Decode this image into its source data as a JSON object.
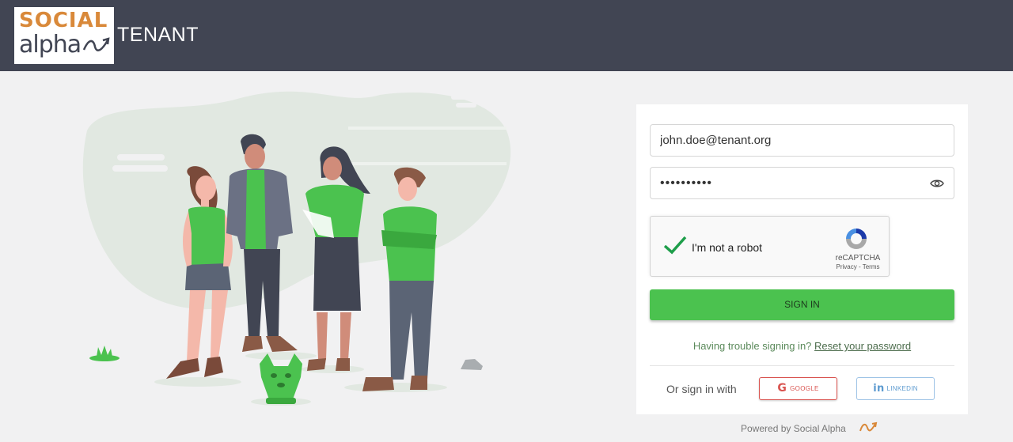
{
  "header": {
    "logo_text_top": "SOCIAL",
    "logo_text_bottom": "alpha",
    "app_name": "TENANT"
  },
  "login": {
    "email_value": "john.doe@tenant.org",
    "password_value": "••••••••••",
    "captcha": {
      "label": "I'm not a robot",
      "brand": "reCAPTCHA",
      "links": "Privacy - Terms",
      "checked": true
    },
    "signin_label": "SIGN IN",
    "trouble_text": "Having trouble signing in?",
    "reset_link": "Reset your password",
    "or_sign_in_with": "Or sign in with",
    "google_label": "GOOGLE",
    "linkedin_label": "LINKEDIN"
  },
  "footer": {
    "powered_by": "Powered by Social Alpha"
  },
  "icons": {
    "eye": "eye-icon",
    "checkmark": "checkmark-icon",
    "recaptcha": "recaptcha-logo-icon",
    "google": "google-icon",
    "linkedin": "linkedin-icon",
    "alpha": "alpha-logo-icon"
  },
  "colors": {
    "header_bg": "#414553",
    "page_bg": "#f1f1f2",
    "brand_orange": "#d9893a",
    "primary_green": "#4bc24f",
    "google_red": "#d9534f",
    "linkedin_blue": "#5e9bd0"
  }
}
